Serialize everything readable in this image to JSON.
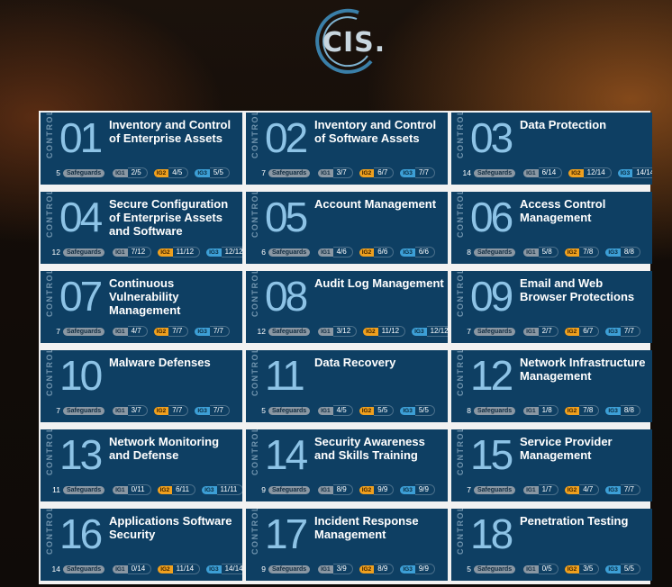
{
  "logo": {
    "text": "CIS."
  },
  "labels": {
    "control_word": "CONTROL",
    "safeguards": "Safeguards",
    "ig1": "IG1",
    "ig2": "IG2",
    "ig3": "IG3"
  },
  "colors": {
    "tile_bg": "#0e3f63",
    "number": "#8dc3e6",
    "ig1": "#8a97a3",
    "ig2": "#f0a01e",
    "ig3": "#3d9fd6"
  },
  "controls": [
    {
      "number": "01",
      "title": "Inventory and Control of Enterprise Assets",
      "safeguards": "5",
      "ig1": "2/5",
      "ig2": "4/5",
      "ig3": "5/5"
    },
    {
      "number": "02",
      "title": "Inventory and Control of Software Assets",
      "safeguards": "7",
      "ig1": "3/7",
      "ig2": "6/7",
      "ig3": "7/7"
    },
    {
      "number": "03",
      "title": "Data Protection",
      "safeguards": "14",
      "ig1": "6/14",
      "ig2": "12/14",
      "ig3": "14/14"
    },
    {
      "number": "04",
      "title": "Secure Configuration of Enterprise Assets and Software",
      "safeguards": "12",
      "ig1": "7/12",
      "ig2": "11/12",
      "ig3": "12/12"
    },
    {
      "number": "05",
      "title": "Account Management",
      "safeguards": "6",
      "ig1": "4/6",
      "ig2": "6/6",
      "ig3": "6/6"
    },
    {
      "number": "06",
      "title": "Access Control Management",
      "safeguards": "8",
      "ig1": "5/8",
      "ig2": "7/8",
      "ig3": "8/8"
    },
    {
      "number": "07",
      "title": "Continuous Vulnerability Management",
      "safeguards": "7",
      "ig1": "4/7",
      "ig2": "7/7",
      "ig3": "7/7"
    },
    {
      "number": "08",
      "title": "Audit Log Management",
      "safeguards": "12",
      "ig1": "3/12",
      "ig2": "11/12",
      "ig3": "12/12"
    },
    {
      "number": "09",
      "title": "Email and Web Browser Protections",
      "safeguards": "7",
      "ig1": "2/7",
      "ig2": "6/7",
      "ig3": "7/7"
    },
    {
      "number": "10",
      "title": "Malware Defenses",
      "safeguards": "7",
      "ig1": "3/7",
      "ig2": "7/7",
      "ig3": "7/7"
    },
    {
      "number": "11",
      "title": "Data Recovery",
      "safeguards": "5",
      "ig1": "4/5",
      "ig2": "5/5",
      "ig3": "5/5"
    },
    {
      "number": "12",
      "title": "Network Infrastructure Management",
      "safeguards": "8",
      "ig1": "1/8",
      "ig2": "7/8",
      "ig3": "8/8"
    },
    {
      "number": "13",
      "title": "Network Monitoring and Defense",
      "safeguards": "11",
      "ig1": "0/11",
      "ig2": "6/11",
      "ig3": "11/11"
    },
    {
      "number": "14",
      "title": "Security Awareness and Skills Training",
      "safeguards": "9",
      "ig1": "8/9",
      "ig2": "9/9",
      "ig3": "9/9"
    },
    {
      "number": "15",
      "title": "Service Provider Management",
      "safeguards": "7",
      "ig1": "1/7",
      "ig2": "4/7",
      "ig3": "7/7"
    },
    {
      "number": "16",
      "title": "Applications Software Security",
      "safeguards": "14",
      "ig1": "0/14",
      "ig2": "11/14",
      "ig3": "14/14"
    },
    {
      "number": "17",
      "title": "Incident Response Management",
      "safeguards": "9",
      "ig1": "3/9",
      "ig2": "8/9",
      "ig3": "9/9"
    },
    {
      "number": "18",
      "title": "Penetration Testing",
      "safeguards": "5",
      "ig1": "0/5",
      "ig2": "3/5",
      "ig3": "5/5"
    }
  ]
}
